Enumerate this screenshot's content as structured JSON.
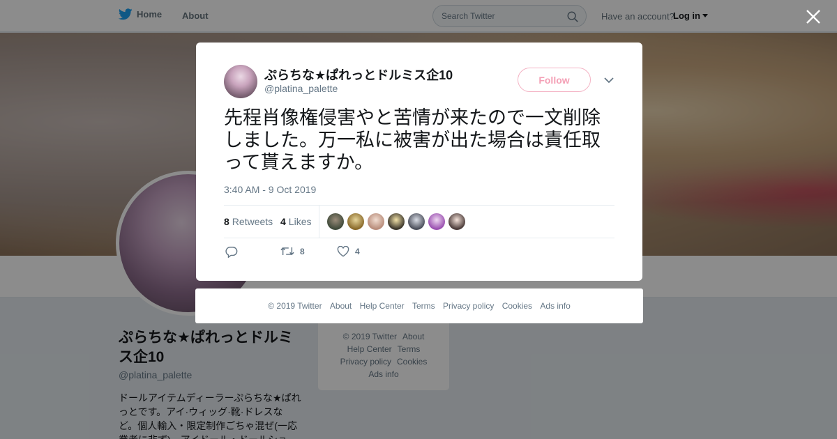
{
  "nav": {
    "home_label": "Home",
    "about_label": "About",
    "search_placeholder": "Search Twitter",
    "have_account": "Have an account?",
    "login_label": "Log in",
    "icons": {
      "brand": "twitter-bird-icon",
      "search": "search-icon",
      "login_caret": "caret-down-icon"
    }
  },
  "profile": {
    "name": "ぷらちな★ぱれっとドルミス企10",
    "handle": "@platina_palette",
    "bio": "ドールアイテムディーラーぷらちな★ぱれっとです。アイ·ウィッグ·靴·ドレスなど。個人輸入・限定制作ごちゃ混ぜ(一応業者に非ず)。アイドール・ドールショ"
  },
  "side_footer": {
    "links": [
      "© 2019 Twitter",
      "About",
      "Help Center",
      "Terms",
      "Privacy policy",
      "Cookies",
      "Ads info"
    ]
  },
  "tweet": {
    "name": "ぷらちな★ぱれっとドルミス企10",
    "handle": "@platina_palette",
    "follow_label": "Follow",
    "text": "先程肖像権侵害やと苦情が来たので一文削除しました。万一私に被害が出た場合は責任取って貰えますか。",
    "time": "3:40 AM - 9 Oct 2019",
    "retweets_count": "8",
    "retweets_label": "Retweets",
    "likes_count": "4",
    "likes_label": "Likes",
    "action_retweet_count": "8",
    "action_like_count": "4",
    "liker_avatars": 7,
    "colors": {
      "follow_accent": "#f4a0b6",
      "text": "#14171a",
      "muted": "#657786"
    },
    "icons": {
      "reply": "reply-icon",
      "retweet": "retweet-icon",
      "like": "heart-icon",
      "menu": "chevron-down-icon",
      "close": "close-icon"
    }
  },
  "footer": {
    "links": [
      "© 2019 Twitter",
      "About",
      "Help Center",
      "Terms",
      "Privacy policy",
      "Cookies",
      "Ads info"
    ]
  }
}
